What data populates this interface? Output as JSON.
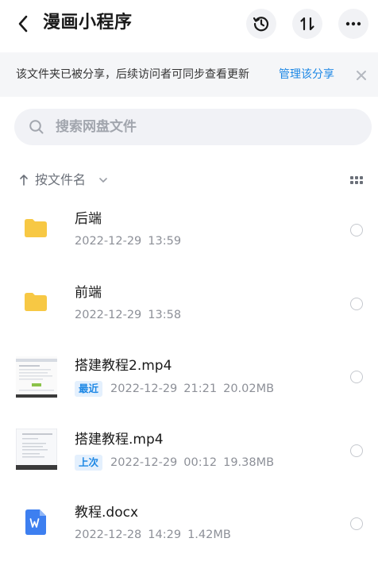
{
  "header": {
    "title": "漫画小程序",
    "icons": {
      "back": "back-chevron-icon",
      "history": "history-icon",
      "sort": "sort-arrows-icon",
      "more": "more-dots-icon"
    }
  },
  "notice": {
    "text": "该文件夹已被分享，后续访问者可同步查看更新",
    "link": "管理该分享",
    "link_color": "#1e88e5"
  },
  "search": {
    "placeholder": "搜索网盘文件"
  },
  "sort_bar": {
    "label": "按文件名",
    "icons": {
      "direction": "up-arrow-icon",
      "dropdown": "chevron-down-icon",
      "view": "grid-view-icon"
    }
  },
  "files": [
    {
      "name": "后端",
      "badge": "",
      "date": "2022-12-29",
      "time": "13:59",
      "size": "",
      "type": "folder"
    },
    {
      "name": "前端",
      "badge": "",
      "date": "2022-12-29",
      "time": "13:58",
      "size": "",
      "type": "folder"
    },
    {
      "name": "搭建教程2.mp4",
      "badge": "最近",
      "date": "2022-12-29",
      "time": "21:21",
      "size": "20.02MB",
      "type": "video"
    },
    {
      "name": "搭建教程.mp4",
      "badge": "上次",
      "date": "2022-12-29",
      "time": "00:12",
      "size": "19.38MB",
      "type": "video"
    },
    {
      "name": "教程.docx",
      "badge": "",
      "date": "2022-12-28",
      "time": "14:29",
      "size": "1.42MB",
      "type": "docx"
    }
  ],
  "colors": {
    "accent": "#1e88e5",
    "folder": "#f7c844",
    "word": "#3d7ff0"
  }
}
